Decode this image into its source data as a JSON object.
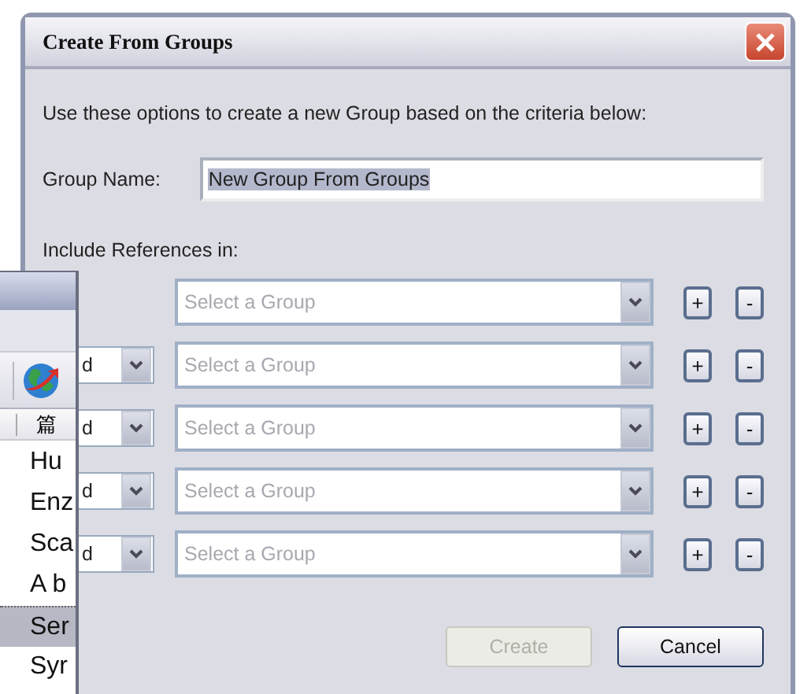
{
  "dialog": {
    "title": "Create From Groups",
    "intro": "Use these options to create a new Group based on the criteria below:",
    "group_name": {
      "label": "Group Name:",
      "value": "New Group From Groups",
      "selected": true
    },
    "criteria_label": "Include References in:",
    "criteria": [
      {
        "kind": "first",
        "placeholder": "Select a Group",
        "add": "+",
        "remove": "-"
      },
      {
        "kind": "joined",
        "operator": "d",
        "placeholder": "Select a Group",
        "add": "+",
        "remove": "-"
      },
      {
        "kind": "joined",
        "operator": "d",
        "placeholder": "Select a Group",
        "add": "+",
        "remove": "-"
      },
      {
        "kind": "joined",
        "operator": "d",
        "placeholder": "Select a Group",
        "add": "+",
        "remove": "-"
      },
      {
        "kind": "joined",
        "operator": "d",
        "placeholder": "Select a Group",
        "add": "+",
        "remove": "-"
      }
    ],
    "buttons": [
      {
        "label": "Create",
        "disabled": true
      },
      {
        "label": "Cancel",
        "disabled": false
      }
    ]
  },
  "background_window": {
    "column_header": "篇",
    "items": [
      {
        "label": "Hu",
        "selected": false
      },
      {
        "label": "Enz",
        "selected": false
      },
      {
        "label": "Sca",
        "selected": false
      },
      {
        "label": "A b",
        "selected": false
      },
      {
        "label": "Ser",
        "selected": true
      },
      {
        "label": "Syr",
        "selected": false
      }
    ]
  }
}
